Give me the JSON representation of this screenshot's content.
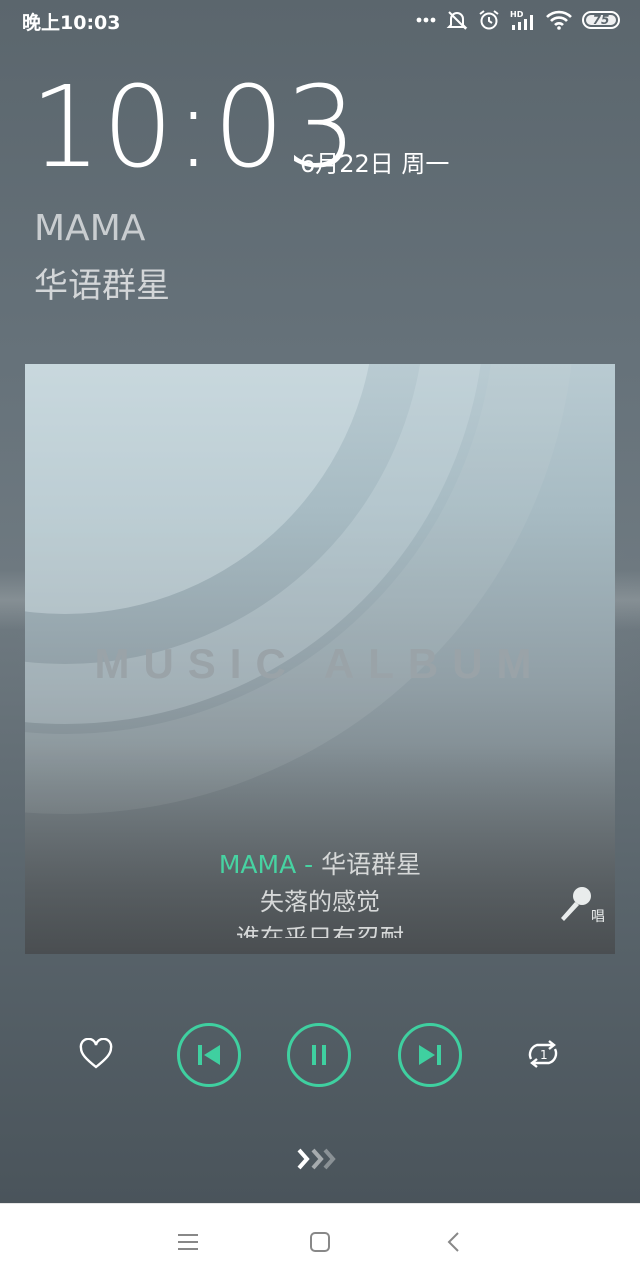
{
  "status_bar": {
    "time": "晚上10:03",
    "battery_level": "75",
    "icons": [
      "more-dots-icon",
      "mute-icon",
      "alarm-icon",
      "hd-signal-icon",
      "wifi-icon",
      "battery-icon"
    ]
  },
  "lockscreen": {
    "clock": "10:03",
    "date": "6月22日 周一"
  },
  "now_playing": {
    "title": "MAMA",
    "artist": "华语群星"
  },
  "album": {
    "art_text": "MUSIC ALBUM",
    "lyrics": {
      "song": "MAMA",
      "separator": " - ",
      "artist": "华语群星",
      "line1": "失落的感觉",
      "line2": "谁在乎只有忍耐"
    },
    "sing_label": "唱"
  },
  "controls": {
    "icons": [
      "heart-icon",
      "previous-icon",
      "pause-icon",
      "next-icon",
      "repeat-one-icon"
    ],
    "accent_color": "#3fd0a0"
  },
  "swipe_hint_icon": "unlock-chevrons-icon",
  "nav_bar": {
    "icons": [
      "menu-icon",
      "home-icon",
      "back-icon"
    ]
  }
}
